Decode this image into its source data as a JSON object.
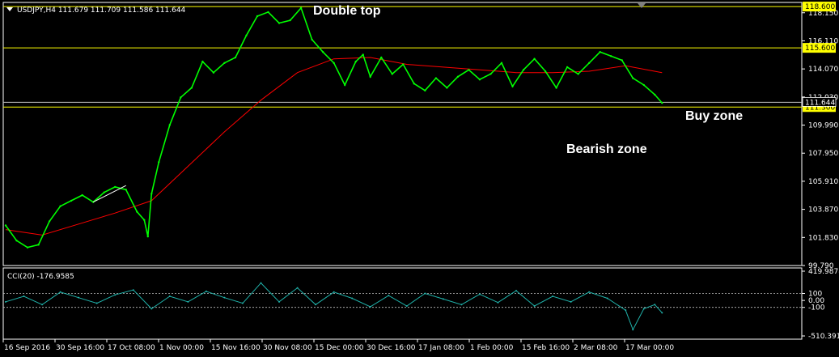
{
  "header": {
    "symbol_line": "USDJPY,H4  111.679 111.709 111.586 111.644"
  },
  "annotations": {
    "double_top": "Double top",
    "buy_zone": "Buy zone",
    "bearish_zone": "Bearish zone"
  },
  "colors": {
    "background": "#000000",
    "price_line": "#00ff00",
    "moving_average": "#ff0000",
    "horizontal_levels": "#ffff00",
    "current_price_line": "#c0c0c0",
    "cci_line": "#20b2aa",
    "grid_border": "#ffffff"
  },
  "chart_data": [
    {
      "type": "line",
      "panel": "price",
      "title": "USDJPY,H4",
      "ohlc_readout": {
        "open": 111.679,
        "high": 111.709,
        "low": 111.586,
        "close": 111.644
      },
      "ylim": [
        99.79,
        118.9
      ],
      "y_ticks": [
        "118.150",
        "116.110",
        "114.070",
        "112.030",
        "109.990",
        "107.950",
        "105.910",
        "103.870",
        "101.830",
        "99.790"
      ],
      "x_ticks": [
        "16 Sep 2016",
        "30 Sep 16:00",
        "17 Oct 08:00",
        "1 Nov 00:00",
        "15 Nov 16:00",
        "30 Nov 08:00",
        "15 Dec 00:00",
        "30 Dec 16:00",
        "17 Jan 08:00",
        "1 Feb 00:00",
        "15 Feb 16:00",
        "2 Mar 08:00",
        "17 Mar 00:00"
      ],
      "horizontal_levels": [
        {
          "value": 118.6,
          "label": "118.600"
        },
        {
          "value": 115.6,
          "label": "115.600"
        },
        {
          "value": 111.3,
          "label": "111.300"
        }
      ],
      "current_price": {
        "value": 111.644,
        "label": "111.644"
      },
      "series": [
        {
          "name": "USDJPY",
          "x_index": [
            0,
            3,
            6,
            9,
            12,
            15,
            18,
            21,
            24,
            27,
            30,
            33,
            36,
            38,
            39,
            40,
            42,
            45,
            48,
            51,
            54,
            57,
            60,
            63,
            66,
            69,
            72,
            75,
            78,
            81,
            84,
            87,
            90,
            93,
            96,
            98,
            100,
            103,
            106,
            109,
            112,
            115,
            118,
            121,
            124,
            127,
            130,
            133,
            136,
            139,
            142,
            145,
            148,
            151,
            154,
            157,
            160,
            163,
            166,
            169,
            172,
            175,
            178,
            180
          ],
          "values": [
            102.7,
            101.6,
            101.1,
            101.3,
            103.0,
            104.1,
            104.5,
            104.9,
            104.4,
            105.1,
            105.5,
            105.3,
            103.7,
            103.1,
            101.9,
            105.0,
            107.3,
            110.0,
            112.0,
            112.7,
            114.6,
            113.8,
            114.5,
            114.9,
            116.5,
            117.9,
            118.2,
            117.4,
            117.6,
            118.5,
            116.2,
            115.3,
            114.5,
            112.9,
            114.6,
            115.1,
            113.5,
            114.9,
            113.7,
            114.4,
            113.0,
            112.5,
            113.4,
            112.7,
            113.5,
            114.0,
            113.3,
            113.7,
            114.5,
            112.8,
            114.0,
            114.8,
            113.9,
            112.7,
            114.2,
            113.7,
            114.5,
            115.3,
            115.0,
            114.7,
            113.4,
            112.9,
            112.2,
            111.6
          ]
        },
        {
          "name": "Moving Average",
          "x_index": [
            0,
            10,
            20,
            30,
            40,
            50,
            60,
            70,
            80,
            90,
            100,
            110,
            120,
            130,
            140,
            150,
            160,
            170,
            180
          ],
          "values": [
            102.4,
            102.0,
            102.8,
            103.6,
            104.5,
            107.0,
            109.5,
            111.8,
            113.8,
            114.8,
            114.9,
            114.4,
            114.2,
            114.0,
            113.8,
            113.8,
            113.9,
            114.3,
            113.8
          ]
        }
      ]
    },
    {
      "type": "line",
      "panel": "indicator",
      "title": "CCI(20) -176.9585",
      "ylim": [
        -510.3915,
        419.9878
      ],
      "y_ticks": [
        "419.9878",
        "100",
        "0.00",
        "-100",
        "-510.3915"
      ],
      "reference_levels": [
        100,
        -100
      ],
      "series": [
        {
          "name": "CCI(20)",
          "x_index": [
            0,
            5,
            10,
            15,
            20,
            25,
            30,
            35,
            40,
            45,
            50,
            55,
            60,
            65,
            70,
            75,
            80,
            85,
            90,
            95,
            100,
            105,
            110,
            115,
            120,
            125,
            130,
            135,
            140,
            145,
            150,
            155,
            160,
            165,
            170,
            172,
            175,
            178,
            180
          ],
          "values": [
            -20,
            60,
            -60,
            120,
            40,
            -40,
            80,
            150,
            -120,
            60,
            -20,
            130,
            40,
            -40,
            250,
            -20,
            180,
            -60,
            120,
            30,
            -90,
            70,
            -80,
            100,
            20,
            -60,
            90,
            -30,
            140,
            -80,
            60,
            -20,
            120,
            30,
            -140,
            -420,
            -120,
            -60,
            -177
          ]
        }
      ]
    }
  ]
}
